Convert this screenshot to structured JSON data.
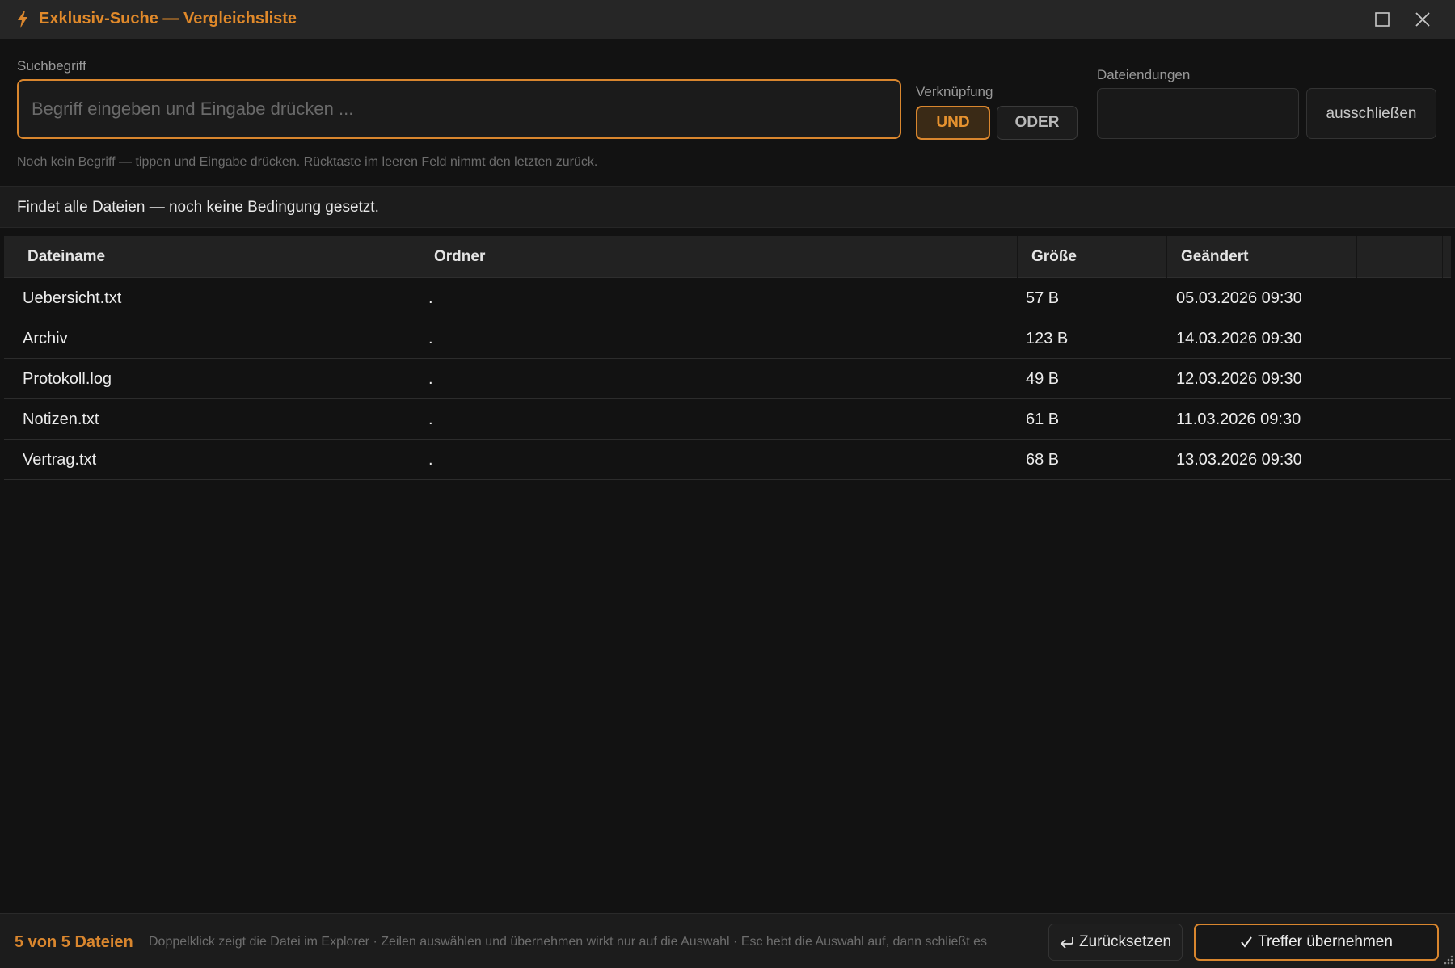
{
  "window": {
    "title": "Exklusiv-Suche — Vergleichsliste",
    "accent_color": "#d9862e"
  },
  "search": {
    "label": "Suchbegriff",
    "value": "",
    "placeholder": "Begriff eingeben und Eingabe drücken ...",
    "hint": "Noch kein Begriff — tippen und Eingabe drücken. Rücktaste im leeren Feld nimmt den letzten zurück."
  },
  "logic": {
    "label": "Verknüpfung",
    "options": [
      "UND",
      "ODER"
    ],
    "selected": "UND"
  },
  "extensions": {
    "label": "Dateiendungen",
    "value": "",
    "exclude_label": "ausschließen"
  },
  "condition_text": "Findet alle Dateien — noch keine Bedingung gesetzt.",
  "table": {
    "columns": [
      "Dateiname",
      "Ordner",
      "Größe",
      "Geändert",
      ""
    ],
    "rows": [
      {
        "name": "Uebersicht.txt",
        "folder": ".",
        "size": "57 B",
        "changed": "05.03.2026 09:30"
      },
      {
        "name": "Archiv",
        "folder": ".",
        "size": "123 B",
        "changed": "14.03.2026 09:30"
      },
      {
        "name": "Protokoll.log",
        "folder": ".",
        "size": "49 B",
        "changed": "12.03.2026 09:30"
      },
      {
        "name": "Notizen.txt",
        "folder": ".",
        "size": "61 B",
        "changed": "11.03.2026 09:30"
      },
      {
        "name": "Vertrag.txt",
        "folder": ".",
        "size": "68 B",
        "changed": "13.03.2026 09:30"
      }
    ]
  },
  "footer": {
    "count": "5 von 5 Dateien",
    "hint": "Doppelklick zeigt die Datei im Explorer · Zeilen auswählen und übernehmen wirkt nur auf die Auswahl · Esc hebt die Auswahl auf, dann schließt es",
    "reset_label": "Zurücksetzen",
    "apply_label": "Treffer übernehmen"
  },
  "icons": {
    "title": "lightning-bolt-icon",
    "maximize": "maximize-icon",
    "close": "close-icon",
    "reset": "return-arrow-icon",
    "apply": "checkmark-icon",
    "resize": "resize-grip-icon"
  }
}
